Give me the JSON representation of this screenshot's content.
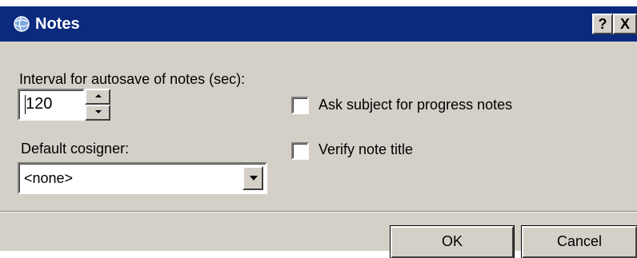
{
  "window": {
    "title": "Notes",
    "icon": "globe-icon",
    "help_label": "?",
    "close_label": "X"
  },
  "autosave": {
    "label": "Interval for autosave of notes (sec):",
    "value": "120"
  },
  "cosigner": {
    "label": "Default cosigner:",
    "selected": "<none>"
  },
  "options": {
    "ask_subject_label": "Ask subject for progress notes",
    "ask_subject_checked": false,
    "verify_title_label": "Verify note title",
    "verify_title_checked": false
  },
  "buttons": {
    "ok": "OK",
    "cancel": "Cancel"
  },
  "colors": {
    "titlebar": "#0b2a7e",
    "face": "#d4d0c8"
  }
}
